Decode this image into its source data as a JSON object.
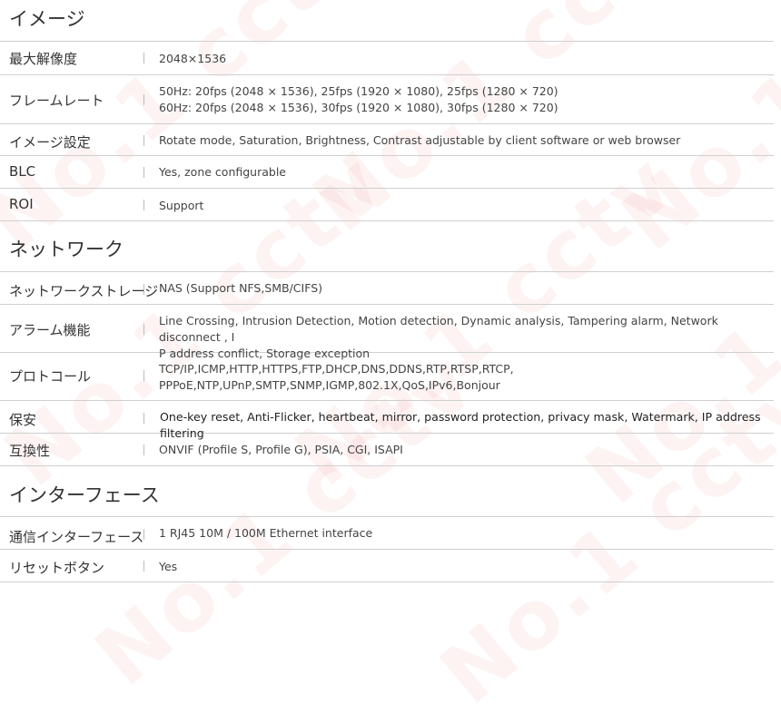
{
  "watermark": "No.1 cctv",
  "sections": [
    {
      "title": "イメージ",
      "rows": [
        {
          "label": "最大解像度",
          "value": [
            "2048×1536"
          ]
        },
        {
          "label": "フレームレート",
          "value": [
            "50Hz: 20fps (2048 × 1536), 25fps (1920 × 1080), 25fps (1280 × 720)",
            "60Hz: 20fps (2048 × 1536), 30fps (1920 × 1080), 30fps (1280 × 720)"
          ]
        },
        {
          "label": "イメージ設定",
          "value": [
            "Rotate mode, Saturation, Brightness, Contrast adjustable by client software or web browser"
          ]
        },
        {
          "label": "BLC",
          "value": [
            "Yes, zone configurable"
          ]
        },
        {
          "label": "ROI",
          "value": [
            "Support"
          ]
        }
      ]
    },
    {
      "title": "ネットワーク",
      "rows": [
        {
          "label": "ネットワークストレージ",
          "value": [
            "NAS (Support NFS,SMB/CIFS)"
          ]
        },
        {
          "label": "アラーム機能",
          "value": [
            "Line Crossing, Intrusion Detection, Motion detection, Dynamic analysis, Tampering alarm, Network disconnect , I",
            "P address conflict, Storage exception"
          ]
        },
        {
          "label": "プロトコール",
          "value": [
            "TCP/IP,ICMP,HTTP,HTTPS,FTP,DHCP,DNS,DDNS,RTP,RTSP,RTCP,",
            "PPPoE,NTP,UPnP,SMTP,SNMP,IGMP,802.1X,QoS,IPv6,Bonjour"
          ]
        },
        {
          "label": "保安",
          "value": [
            "One-key reset, Anti-Flicker, heartbeat, mirror, password protection, privacy mask, Watermark, IP address filtering"
          ]
        },
        {
          "label": "互換性",
          "value": [
            "ONVIF (Profile S, Profile G), PSIA, CGI, ISAPI"
          ]
        }
      ]
    },
    {
      "title": "インターフェース",
      "rows": [
        {
          "label": "通信インターフェース",
          "value": [
            "1 RJ45 10M / 100M Ethernet interface"
          ]
        },
        {
          "label": "リセットボタン",
          "value": [
            "Yes"
          ]
        }
      ]
    }
  ]
}
